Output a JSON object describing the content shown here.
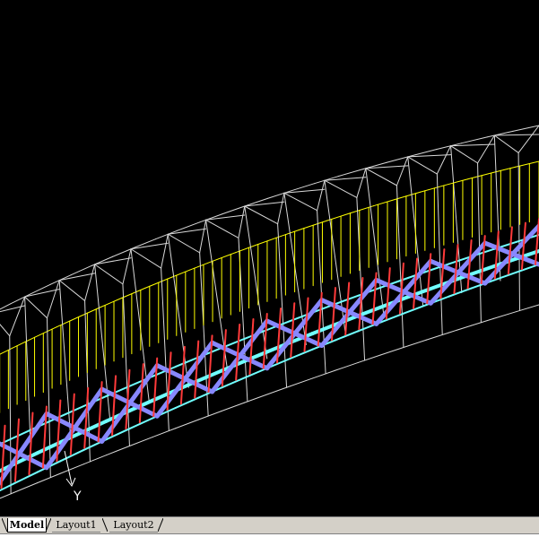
{
  "canvas": {
    "background": "#000000",
    "colors": {
      "frame": "#d8d8d8",
      "hangers": "#ffff00",
      "deck": "#70ffff",
      "beams": "#ff3a3a",
      "bracing": "#8888ff",
      "ucs": "#ffffff"
    }
  },
  "ucs": {
    "axis_label": "Y"
  },
  "tabs": [
    {
      "label": "Model",
      "active": true
    },
    {
      "label": "Layout1",
      "active": false
    },
    {
      "label": "Layout2",
      "active": false
    }
  ]
}
